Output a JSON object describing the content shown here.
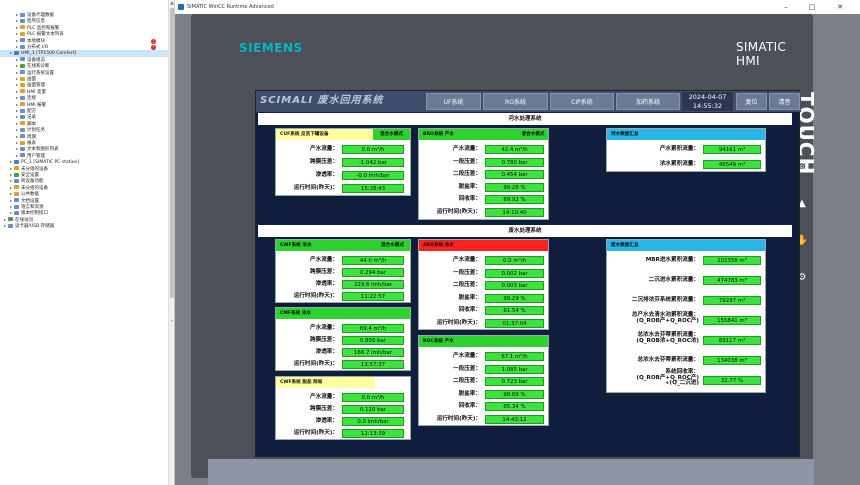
{
  "tree": [
    {
      "label": "设备代理数据",
      "indent": 1,
      "color": "#6a8fc7"
    },
    {
      "label": "程序信息",
      "indent": 1,
      "color": "#6a8fc7"
    },
    {
      "label": "PLC 监控和报警",
      "indent": 1,
      "color": "#e0a030"
    },
    {
      "label": "PLC 报警文本列表",
      "indent": 1,
      "color": "#e0a030"
    },
    {
      "label": "本地模块",
      "indent": 1,
      "color": "#6a8fc7",
      "warn": true
    },
    {
      "label": "分布式 I/O",
      "indent": 1,
      "color": "#6a8fc7",
      "warn": true
    },
    {
      "label": "HMI_1 [TP1500 Comfort]",
      "indent": 0,
      "color": "#3a7fd0",
      "selected": true
    },
    {
      "label": "设备组态",
      "indent": 1,
      "color": "#6a8fc7"
    },
    {
      "label": "在线和诊断",
      "indent": 1,
      "color": "#4aa04a"
    },
    {
      "label": "运行系统设置",
      "indent": 1,
      "color": "#6a8fc7"
    },
    {
      "label": "画面",
      "indent": 1,
      "color": "#e0a030"
    },
    {
      "label": "画面管理",
      "indent": 1,
      "color": "#e0a030"
    },
    {
      "label": "HMI 变量",
      "indent": 1,
      "color": "#e0a030"
    },
    {
      "label": "连接",
      "indent": 1,
      "color": "#6a8fc7"
    },
    {
      "label": "HMI 报警",
      "indent": 1,
      "color": "#e0a030"
    },
    {
      "label": "配方",
      "indent": 1,
      "color": "#6a8fc7"
    },
    {
      "label": "记录",
      "indent": 1,
      "color": "#6a8fc7"
    },
    {
      "label": "脚本",
      "indent": 1,
      "color": "#e0a030"
    },
    {
      "label": "计划任务",
      "indent": 1,
      "color": "#6a8fc7"
    },
    {
      "label": "周期",
      "indent": 1,
      "color": "#6a8fc7"
    },
    {
      "label": "报表",
      "indent": 1,
      "color": "#e0a030"
    },
    {
      "label": "文本和图形列表",
      "indent": 1,
      "color": "#6a8fc7"
    },
    {
      "label": "用户管理",
      "indent": 1,
      "color": "#6a8fc7"
    },
    {
      "label": "PC_1 [SIMATIC PC station]",
      "indent": 0,
      "color": "#3a7fd0"
    },
    {
      "label": "未分组的设备",
      "indent": 0,
      "color": "#e0a030"
    },
    {
      "label": "安全设置",
      "indent": 0,
      "color": "#4aa04a"
    },
    {
      "label": "跨设备功能",
      "indent": 0,
      "color": "#6a8fc7"
    },
    {
      "label": "未分组的设备",
      "indent": 0,
      "color": "#e0a030"
    },
    {
      "label": "公共数据",
      "indent": 0,
      "color": "#e0a030"
    },
    {
      "label": "文档设置",
      "indent": 0,
      "color": "#6a8fc7"
    },
    {
      "label": "语言和资源",
      "indent": 0,
      "color": "#6a8fc7"
    },
    {
      "label": "版本控制接口",
      "indent": 0,
      "color": "#6a8fc7"
    },
    {
      "label": "在线访问",
      "indent": -1,
      "color": "#4aa04a"
    },
    {
      "label": "读卡器/USB 存储器",
      "indent": -1,
      "color": "#6a8fc7"
    }
  ],
  "runtime": {
    "title": "SIMATIC WinCC Runtime Advanced",
    "min": "–",
    "max": "□",
    "close": "✕"
  },
  "panel": {
    "brand": "SIEMENS",
    "product": "SIMATIC HMI",
    "touch": "TOUCH"
  },
  "nav": {
    "logo": "SCIMALI 废水回用系统",
    "buttons": [
      "UF系统",
      "RO系统",
      "CIP系统",
      "加药系统"
    ],
    "date": "2024-04-07",
    "time": "14:55:32",
    "reset": "复位",
    "clear": "清音"
  },
  "river": {
    "title": "河水处理系统",
    "cuf": {
      "title": "CUF系统 反洗下罐设备",
      "mode": "混合水模式",
      "rows": [
        {
          "label": "产水流量：",
          "value": "0.0 m³/h"
        },
        {
          "label": "跨膜压差：",
          "value": "-1.042 bar"
        },
        {
          "label": "渗透率：",
          "value": "-0.0 lmh/bar"
        },
        {
          "label": "运行时间(昨天)：",
          "value": "15:28:43"
        }
      ]
    },
    "bro": {
      "title": "BRO系统 产水",
      "mode": "混合水模式",
      "rows": [
        {
          "label": "产水流量：",
          "value": "42.4 m³/h"
        },
        {
          "label": "一段压差：",
          "value": "0.780 bar"
        },
        {
          "label": "二段压差：",
          "value": "0.454 bar"
        },
        {
          "label": "脱盐率：",
          "value": "99.28 %"
        },
        {
          "label": "回收率：",
          "value": "69.92 %"
        },
        {
          "label": "运行时间(昨天)：",
          "value": "14:10:40"
        }
      ]
    },
    "summary": {
      "title": "河水数据汇总",
      "rows": [
        {
          "label": "产水累积流量：",
          "value": "94161 m³"
        },
        {
          "label": "浓水累积流量：",
          "value": "46549 m³"
        }
      ]
    }
  },
  "waste": {
    "title": "废水处理系统",
    "cwf": {
      "title": "CWF系统 浓水",
      "mode": "混合水模式",
      "rows": [
        {
          "label": "产水流量：",
          "value": "44.0 m³/h"
        },
        {
          "label": "跨膜压差：",
          "value": "0.294 bar"
        },
        {
          "label": "渗透率：",
          "value": "229.6 lmh/bar"
        },
        {
          "label": "运行时间(昨天)：",
          "value": "11:22:57"
        }
      ]
    },
    "cmf": {
      "title": "CMF系统 浓水",
      "rows": [
        {
          "label": "产水流量：",
          "value": "69.4 m³/h"
        },
        {
          "label": "跨膜压差：",
          "value": "0.856 bar"
        },
        {
          "label": "渗透率：",
          "value": "166.7 lmh/bar"
        },
        {
          "label": "运行时间(昨天)：",
          "value": "13:57:37"
        }
      ]
    },
    "cwf2": {
      "title": "CWF系统 脱盐 除垢",
      "rows": [
        {
          "label": "产水流量：",
          "value": "0.0 m³/h"
        },
        {
          "label": "跨膜压差：",
          "value": "0.120 bar"
        },
        {
          "label": "渗透率：",
          "value": "0.0 lmh/bar"
        },
        {
          "label": "运行时间(昨天)：",
          "value": "12:13:39"
        }
      ]
    },
    "aro": {
      "title": "ARO系统 浓水",
      "rows": [
        {
          "label": "产水流量：",
          "value": "0.0 m³/h"
        },
        {
          "label": "一段压差：",
          "value": "0.002 bar"
        },
        {
          "label": "二段压差：",
          "value": "0.003 bar"
        },
        {
          "label": "脱盐率：",
          "value": "99.29 %"
        },
        {
          "label": "回收率：",
          "value": "61.54 %"
        },
        {
          "label": "运行时间(昨天)：",
          "value": "01:37:04"
        }
      ]
    },
    "roc": {
      "title": "ROC系统 产水",
      "rows": [
        {
          "label": "产水流量：",
          "value": "67.1 m³/h"
        },
        {
          "label": "一段压差：",
          "value": "1.085 bar"
        },
        {
          "label": "二段压差：",
          "value": "0.723 bar"
        },
        {
          "label": "脱盐率：",
          "value": "98.89 %"
        },
        {
          "label": "回收率：",
          "value": "65.34 %"
        },
        {
          "label": "运行时间(昨天)：",
          "value": "14:43:12"
        }
      ]
    },
    "summary": {
      "title": "废水数据汇总",
      "rows": [
        {
          "label": "MBR进水累积流量：",
          "value": "202356 m³"
        },
        {
          "label": "二沉进水累积流量：",
          "value": "474783 m³"
        },
        {
          "label": "二沉排浓芬系统累积流量：",
          "value": "79297 m³"
        },
        {
          "label": "总产水去清水池累积流量：\n(Q_ROB产+Q_ROC产)",
          "value": "155841 m³"
        },
        {
          "label": "总浓水去芬蒂累积流量：\n(Q_ROB浓+Q_ROC浓)",
          "value": "89117 m³"
        },
        {
          "label": "总浓水去芬蒂累积流量：",
          "value": "134038 m³"
        },
        {
          "label": "系统回收率：\n(Q_ROB产+Q_ROC产)\n÷(Q_二沉进)",
          "value": "32.77 %"
        }
      ]
    }
  },
  "colors": {
    "green": "#3ee23e",
    "yellow_header": "#ffffa0",
    "cyan_header": "#29b6e8",
    "red_header": "#ff2020",
    "green_header": "#2ed22e"
  }
}
